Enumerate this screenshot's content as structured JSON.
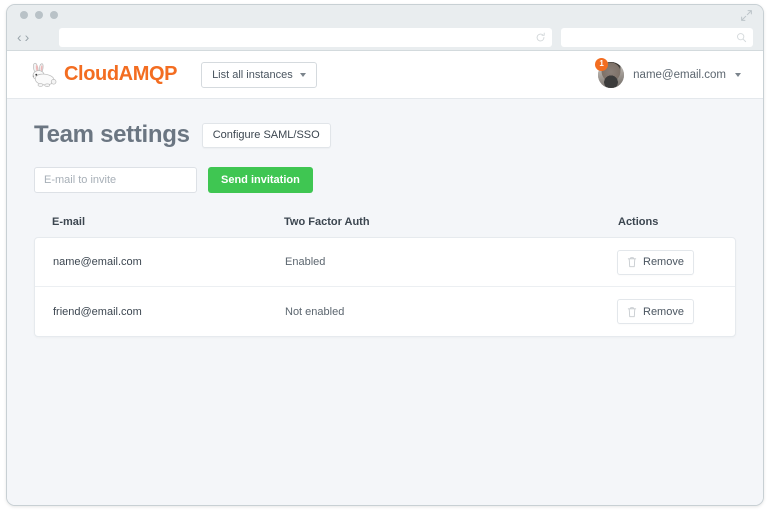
{
  "browser": {
    "url_value": "",
    "url_placeholder": "",
    "search_value": "",
    "search_placeholder": "",
    "back_glyph": "‹",
    "forward_glyph": "›",
    "icons": {
      "reload": "reload-icon",
      "search": "search-icon",
      "expand": "expand-icon",
      "traffic_lights": [
        "close-dot",
        "minimize-dot",
        "maximize-dot"
      ]
    }
  },
  "header": {
    "brand_name": "CloudAMQP",
    "logo_icon": "rabbit-logo-icon",
    "nav_button_label": "List all instances",
    "user_email": "name@email.com",
    "notification_count": "1",
    "avatar_icon": "user-avatar"
  },
  "page": {
    "title": "Team settings",
    "saml_button_label": "Configure SAML/SSO"
  },
  "invite": {
    "input_value": "",
    "input_placeholder": "E-mail to invite",
    "send_label": "Send invitation"
  },
  "table": {
    "headers": {
      "email": "E-mail",
      "two_factor": "Two Factor Auth",
      "actions": "Actions"
    },
    "rows": [
      {
        "email": "name@email.com",
        "two_factor": "Enabled",
        "action_label": "Remove"
      },
      {
        "email": "friend@email.com",
        "two_factor": "Not enabled",
        "action_label": "Remove"
      }
    ]
  },
  "colors": {
    "brand_orange": "#f36d21",
    "success_green": "#3fc652",
    "page_background": "#f4f6f9",
    "text_dark": "#3c4650",
    "text_muted": "#6b7682"
  }
}
